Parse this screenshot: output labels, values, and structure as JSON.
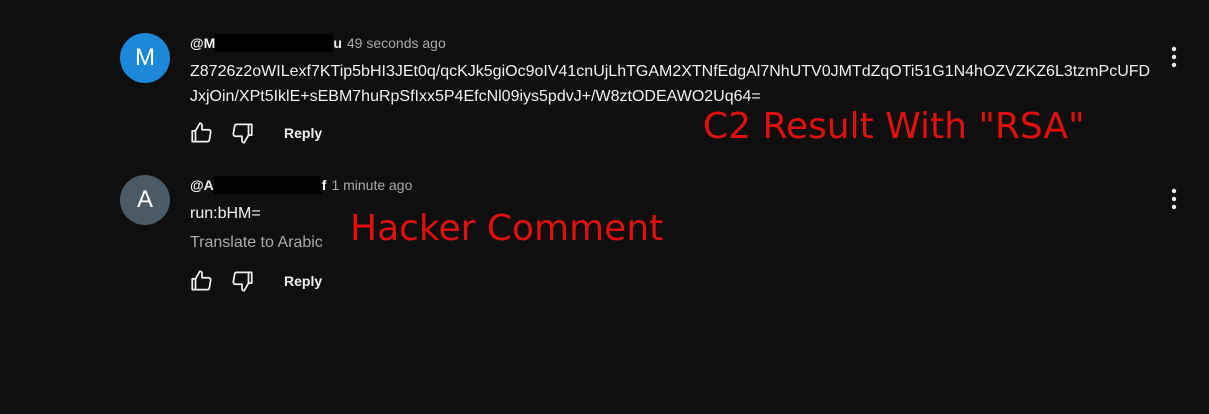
{
  "comments": [
    {
      "avatar_letter": "M",
      "avatar_color": "#1e88d8",
      "handle_start": "@M",
      "handle_end": "u",
      "timestamp": "49 seconds ago",
      "text": "Z8726z2oWILexf7KTip5bHI3JEt0q/qcKJk5giOc9oIV41cnUjLhTGAM2XTNfEdgAl7NhUTV0JMTdZqOTi51G1N4hOZVZKZ6L3tzmPcUFDJxjOin/XPt5IklE+sEBM7huRpSfIxx5P4EfcNl09iys5pdvJ+/W8ztODEAWO2Uq64=",
      "reply_label": "Reply"
    },
    {
      "avatar_letter": "A",
      "avatar_color": "#4a5a66",
      "handle_start": "@A",
      "handle_end": "f",
      "timestamp": "1 minute ago",
      "text": "run:bHM=",
      "translate_label": "Translate to Arabic",
      "reply_label": "Reply"
    }
  ],
  "annotations": {
    "c2_result": "C2 Result With \"RSA\"",
    "hacker_comment": "Hacker Comment",
    "color": "#e01010"
  },
  "icons": [
    "like-icon",
    "dislike-icon",
    "more-vert-icon"
  ]
}
